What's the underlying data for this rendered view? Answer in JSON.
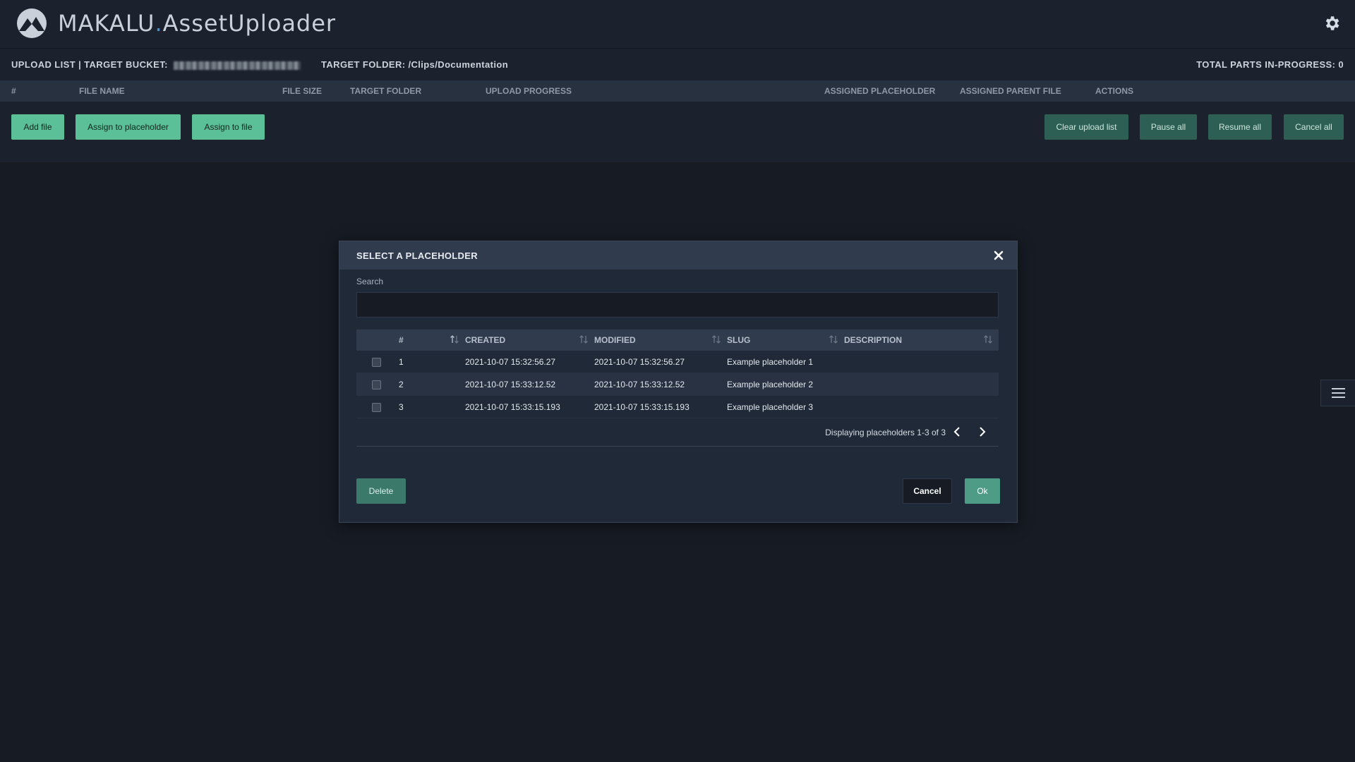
{
  "app": {
    "title_brand": "MAKALU",
    "title_dot": ".",
    "title_product": "AssetUploader",
    "logo_icon": "mountain-logo-icon",
    "settings_icon": "gear-icon"
  },
  "info_bar": {
    "upload_list_label": "UPLOAD LIST | TARGET BUCKET:",
    "target_folder_label": "TARGET FOLDER: /Clips/Documentation",
    "total_parts_label": "TOTAL PARTS IN-PROGRESS: 0"
  },
  "columns": {
    "num": "#",
    "file_name": "FILE NAME",
    "file_size": "FILE SIZE",
    "target_folder": "TARGET FOLDER",
    "upload_progress": "UPLOAD PROGRESS",
    "assigned_placeholder": "ASSIGNED PLACEHOLDER",
    "assigned_parent_file": "ASSIGNED PARENT FILE",
    "actions": "ACTIONS"
  },
  "toolbar": {
    "add_file": "Add file",
    "assign_placeholder": "Assign to placeholder",
    "assign_file": "Assign to file",
    "clear_list": "Clear upload list",
    "pause_all": "Pause all",
    "resume_all": "Resume all",
    "cancel_all": "Cancel all"
  },
  "modal": {
    "title": "SELECT A PLACEHOLDER",
    "search_label": "Search",
    "search_value": "",
    "headers": {
      "num": "#",
      "created": "CREATED",
      "modified": "MODIFIED",
      "slug": "SLUG",
      "description": "DESCRIPTION"
    },
    "rows": [
      {
        "num": "1",
        "created": "2021-10-07 15:32:56.27",
        "modified": "2021-10-07 15:32:56.27",
        "slug": "Example placeholder 1",
        "description": ""
      },
      {
        "num": "2",
        "created": "2021-10-07 15:33:12.52",
        "modified": "2021-10-07 15:33:12.52",
        "slug": "Example placeholder 2",
        "description": ""
      },
      {
        "num": "3",
        "created": "2021-10-07 15:33:15.193",
        "modified": "2021-10-07 15:33:15.193",
        "slug": "Example placeholder 3",
        "description": ""
      }
    ],
    "pager_text": "Displaying placeholders 1-3 of 3",
    "delete_label": "Delete",
    "cancel_label": "Cancel",
    "ok_label": "Ok"
  },
  "colors": {
    "background": "#161b24",
    "panel": "#1b222d",
    "accent_green": "#5bbf98",
    "accent_blue_dot": "#3f8fd1"
  }
}
